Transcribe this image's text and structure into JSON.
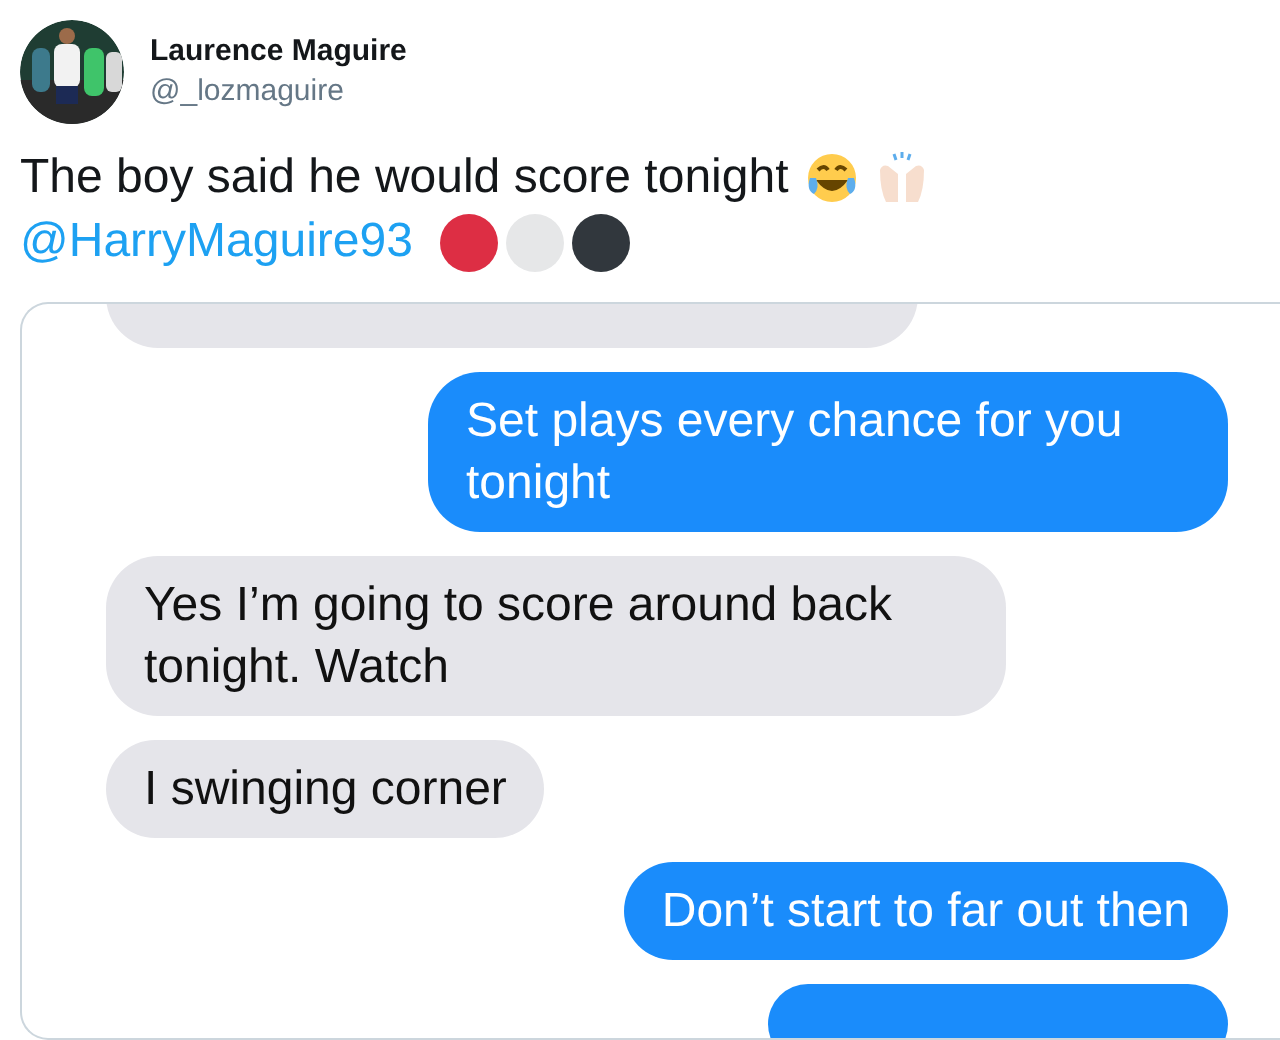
{
  "author": {
    "name": "Laurence Maguire",
    "handle": "@_lozmaguire"
  },
  "tweet": {
    "text": "The boy said he would score tonight",
    "mention": "@HarryMaguire93"
  },
  "circles": [
    {
      "color": "#dd2e44"
    },
    {
      "color": "#e6e7e8"
    },
    {
      "color": "#31373d"
    }
  ],
  "attachment": {
    "kind": "picture",
    "messages": [
      {
        "kind": "received"
      },
      {
        "kind": "sent",
        "text": "Set plays every chance for you tonight"
      },
      {
        "kind": "received",
        "text": "Yes I’m going to score around back tonight. Watch"
      },
      {
        "kind": "received",
        "text": "I swinging corner"
      },
      {
        "kind": "sent",
        "text": "Don’t start to far out then"
      },
      {
        "kind": "sent"
      }
    ]
  }
}
